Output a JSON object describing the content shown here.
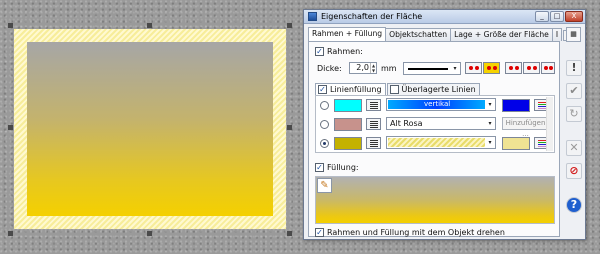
{
  "colors": {
    "frame_stripe": "#f7ed9a",
    "fill_top": "#a6a6a6",
    "fill_bottom": "#f4d000",
    "cyan": "#00ffff",
    "blue": "#0000e8",
    "rose": "#c7928c",
    "olive": "#c4b200",
    "pale_yellow": "#efe393"
  },
  "dialog": {
    "title": "Eigenschaften der Fläche",
    "window_buttons": {
      "minimize": "_",
      "maximize": "□",
      "close": "X"
    },
    "tabs": [
      "Rahmen + Füllung",
      "Objektschatten",
      "Lage + Größe der Fläche",
      "I"
    ],
    "tab_scroll": {
      "left": "◂",
      "right": "▸"
    },
    "rahmen": {
      "checkbox_label": "Rahmen:",
      "checked": true,
      "dicke_label": "Dicke:",
      "dicke_value": "2,0",
      "unit": "mm"
    },
    "line_tabs": [
      {
        "label": "Linienfüllung",
        "checked": true
      },
      {
        "label": "Überlagerte Linien",
        "checked": false
      }
    ],
    "line_rows": [
      {
        "selected": false,
        "swatch": "cyan",
        "gradient_label": "vertikal",
        "end_color": "blue"
      },
      {
        "selected": false,
        "swatch": "rose",
        "name": "Alt Rosa",
        "add_label": "Hinzufügen ..."
      },
      {
        "selected": true,
        "swatch": "olive",
        "end_color": "pale_yellow"
      }
    ],
    "fuellung": {
      "checkbox_label": "Füllung:",
      "checked": true
    },
    "rotate": {
      "checkbox_label": "Rahmen und Füllung mit dem Objekt drehen",
      "checked": true
    },
    "side_icons": [
      "grid-icon",
      "exclamation-icon",
      "checkmark-icon",
      "refresh-icon",
      "x-icon",
      "no-entry-icon",
      "help-icon"
    ],
    "side_glyphs": {
      "grid": "▦",
      "exclamation": "!",
      "check": "✔",
      "refresh": "↻",
      "x": "✕",
      "no_entry": "⊘",
      "help": "?"
    }
  }
}
